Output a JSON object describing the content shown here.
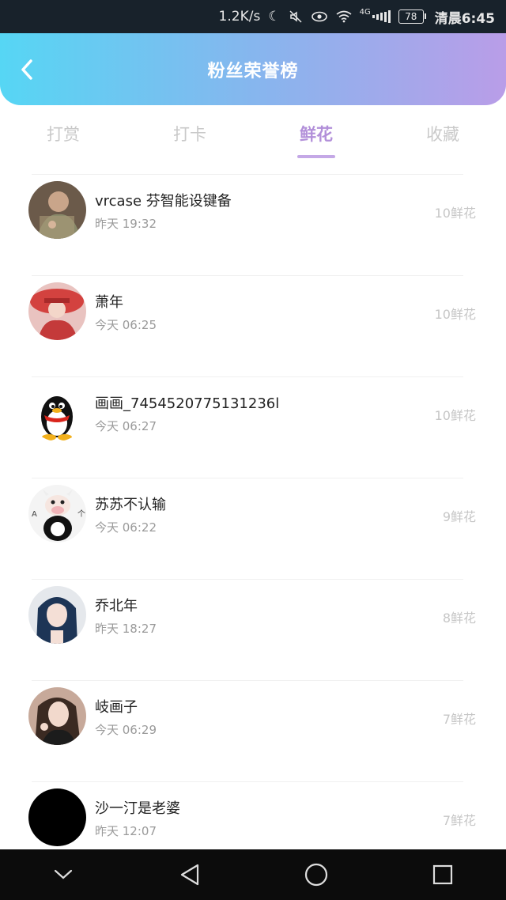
{
  "status_bar": {
    "net_speed": "1.2K/s",
    "network": "4G",
    "battery": "78",
    "time": "清晨6:45"
  },
  "header": {
    "title": "粉丝荣誉榜"
  },
  "tabs": [
    {
      "label": "打赏",
      "active": false
    },
    {
      "label": "打卡",
      "active": false
    },
    {
      "label": "鲜花",
      "active": true
    },
    {
      "label": "收藏",
      "active": false
    }
  ],
  "fans": [
    {
      "name": "vrcase 芬智能设键备",
      "time": "昨天 19:32",
      "count": "10鲜花",
      "avatar": "photo-avatar"
    },
    {
      "name": "萧年",
      "time": "今天 06:25",
      "count": "10鲜花",
      "avatar": "photo-avatar"
    },
    {
      "name": "画画_7454520775131236l",
      "time": "今天 06:27",
      "count": "10鲜花",
      "avatar": "qq-penguin-avatar"
    },
    {
      "name": "苏苏不认输",
      "time": "今天 06:22",
      "count": "9鲜花",
      "avatar": "cow-cartoon-avatar"
    },
    {
      "name": "乔北年",
      "time": "昨天 18:27",
      "count": "8鲜花",
      "avatar": "photo-avatar"
    },
    {
      "name": "岐画子",
      "time": "今天 06:29",
      "count": "7鲜花",
      "avatar": "photo-avatar"
    },
    {
      "name": "沙一汀是老婆",
      "time": "昨天 12:07",
      "count": "7鲜花",
      "avatar": "black-avatar"
    }
  ],
  "colors": {
    "header_gradient_start": "#56d6f4",
    "header_gradient_end": "#b99de8",
    "active_tab": "#b28fd9",
    "inactive_tab": "#c9c9c9"
  }
}
